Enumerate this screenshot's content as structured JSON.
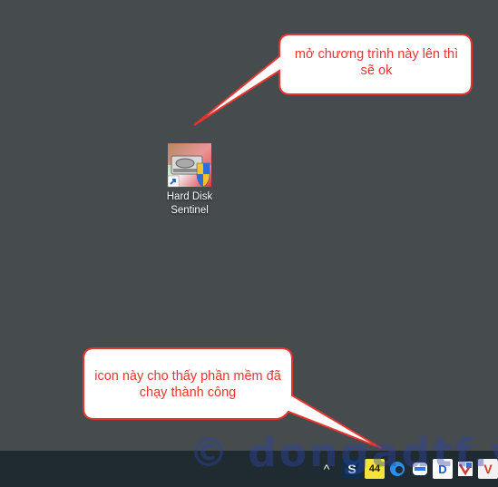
{
  "desktop": {
    "shortcut": {
      "label": "Hard Disk Sentinel",
      "icon": "hard-disk-sentinel-icon"
    },
    "callouts": [
      {
        "text": "mở chương trình này lên thì sẽ ok"
      },
      {
        "text": "icon này cho thấy phần mềm đã chạy thành công"
      }
    ]
  },
  "watermark": "© dongadtf.vn",
  "taskbar": {
    "tray": [
      {
        "icon": "chevron-up-icon",
        "text": "^"
      },
      {
        "icon": "s-app-icon",
        "text": "S"
      },
      {
        "icon": "hard-disk-sentinel-tray-icon",
        "text": "44"
      },
      {
        "icon": "edge-icon",
        "text": ""
      },
      {
        "icon": "zalo-icon",
        "text": ""
      },
      {
        "icon": "d-app-icon",
        "text": "D"
      },
      {
        "icon": "unikey-icon",
        "text": ""
      },
      {
        "icon": "v-app-icon",
        "text": "V"
      }
    ]
  }
}
